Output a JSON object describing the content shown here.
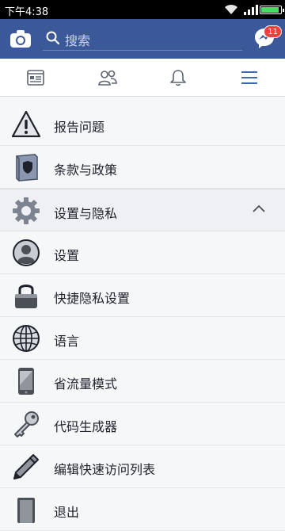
{
  "status": {
    "time": "下午4:38"
  },
  "header": {
    "search_placeholder": "搜索",
    "messenger_badge": "11"
  },
  "tabs": [
    {
      "name": "news-feed"
    },
    {
      "name": "friends"
    },
    {
      "name": "notifications"
    },
    {
      "name": "menu",
      "active": true
    }
  ],
  "menu": {
    "items": [
      {
        "label": "报告问题",
        "icon": "warning-icon"
      },
      {
        "label": "条款与政策",
        "icon": "book-icon"
      },
      {
        "label": "设置与隐私",
        "icon": "gear-icon",
        "expanded": true
      },
      {
        "label": "设置",
        "icon": "profile-icon"
      },
      {
        "label": "快捷隐私设置",
        "icon": "lock-icon"
      },
      {
        "label": "语言",
        "icon": "globe-icon"
      },
      {
        "label": "省流量模式",
        "icon": "phone-icon"
      },
      {
        "label": "代码生成器",
        "icon": "key-icon"
      },
      {
        "label": "编辑快速访问列表",
        "icon": "pencil-icon"
      },
      {
        "label": "退出",
        "icon": "door-icon"
      }
    ]
  },
  "colors": {
    "brand": "#3b5998",
    "active_tab": "#4267b2",
    "badge": "#fa3e3e"
  }
}
